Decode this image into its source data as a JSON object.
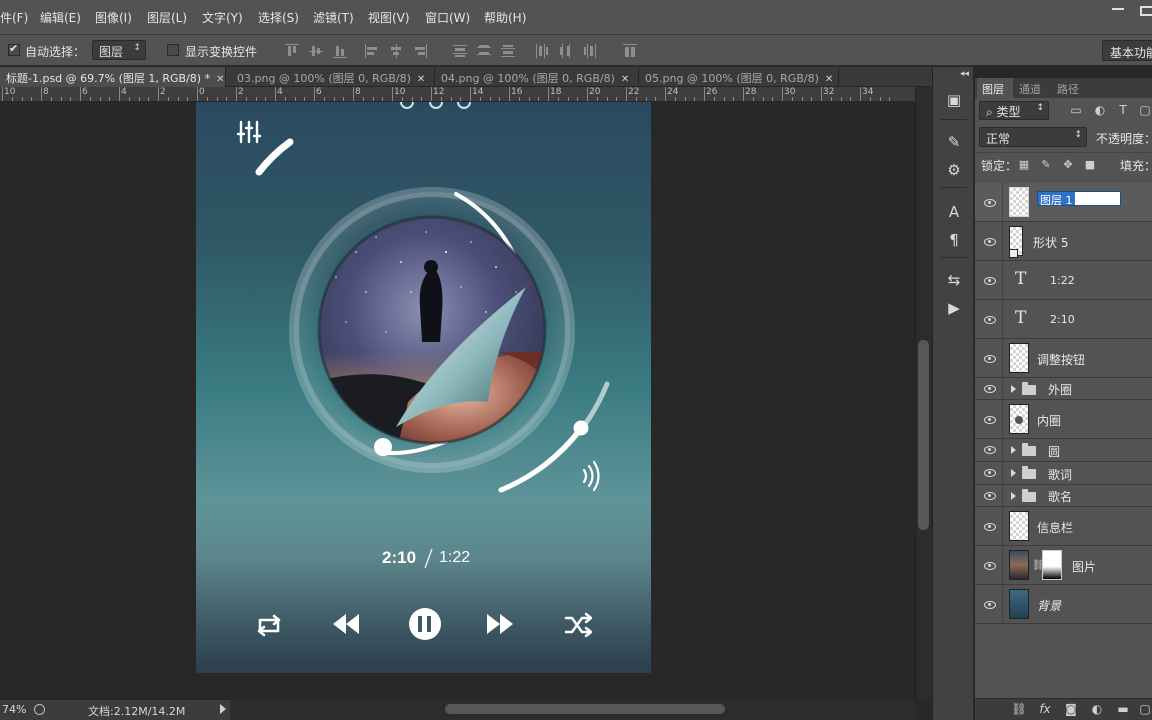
{
  "menubar": {
    "items": [
      "件(F)",
      "编辑(E)",
      "图像(I)",
      "图层(L)",
      "文字(Y)",
      "选择(S)",
      "滤镜(T)",
      "视图(V)",
      "窗口(W)",
      "帮助(H)"
    ]
  },
  "options": {
    "auto_select_label": "自动选择：",
    "auto_select_checked": true,
    "layer_dropdown": "图层",
    "show_transform_label": "显示变换控件",
    "show_transform_checked": false,
    "workspace": "基本功能"
  },
  "tabs": [
    {
      "label": "标题-1.psd @ 69.7% (图层 1, RGB/8) *",
      "active": true
    },
    {
      "label": "03.png @ 100% (图层 0, RGB/8)",
      "active": false
    },
    {
      "label": "04.png @ 100% (图层 0, RGB/8)",
      "active": false
    },
    {
      "label": "05.png @ 100% (图层 0, RGB/8)",
      "active": false
    }
  ],
  "ruler": {
    "ticks": [
      "10",
      "8",
      "6",
      "4",
      "2",
      "0",
      "2",
      "4",
      "6",
      "8",
      "10",
      "12",
      "14",
      "16",
      "18",
      "20",
      "22",
      "24",
      "26",
      "28",
      "30",
      "32",
      "34"
    ]
  },
  "status": {
    "zoom": "74%",
    "doc_info": "文档:2.12M/14.2M"
  },
  "player": {
    "elapsed": "2:10",
    "separator": "/",
    "total": "1:22",
    "progress_fraction": 0.35,
    "volume_fraction": 0.8
  },
  "panel": {
    "tabs": [
      "图层",
      "通道",
      "路径"
    ],
    "filter_label": "类型",
    "blend_mode": "正常",
    "opacity_label": "不透明度：",
    "lock_label": "锁定：",
    "fill_label": "填充："
  },
  "layers": [
    {
      "name": "图层 1",
      "kind": "raster",
      "selected": true,
      "editing": true
    },
    {
      "name": "形状 5",
      "kind": "shape"
    },
    {
      "name": "1:22",
      "kind": "text"
    },
    {
      "name": "2:10",
      "kind": "text"
    },
    {
      "name": "调整按钮",
      "kind": "raster"
    },
    {
      "name": "外圈",
      "kind": "group"
    },
    {
      "name": "内圈",
      "kind": "raster"
    },
    {
      "name": "圆",
      "kind": "group"
    },
    {
      "name": "歌词",
      "kind": "group"
    },
    {
      "name": "歌名",
      "kind": "group"
    },
    {
      "name": "信息栏",
      "kind": "raster"
    },
    {
      "name": "图片",
      "kind": "masked"
    },
    {
      "name": "背景",
      "kind": "background"
    }
  ],
  "colors": {
    "ui_bg": "#535353",
    "canvas_bg": "#282828",
    "selection_blue": "#3170c9"
  }
}
